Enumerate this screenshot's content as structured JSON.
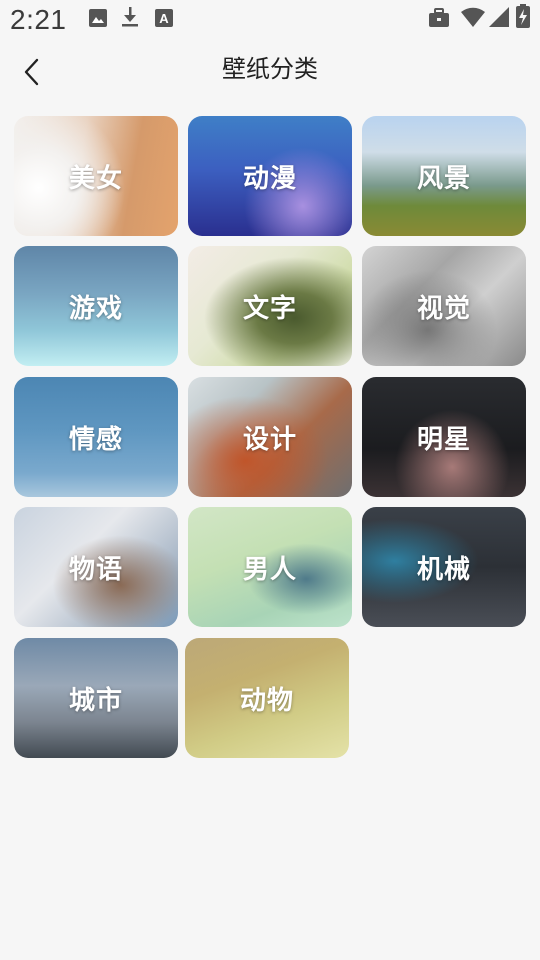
{
  "status_bar": {
    "time": "2:21",
    "left_icons": [
      "image-icon",
      "download-icon",
      "font-icon"
    ],
    "right_icons": [
      "briefcase-icon",
      "wifi-icon",
      "signal-icon",
      "battery-charging-icon"
    ]
  },
  "header": {
    "back_icon": "chevron-left-icon",
    "title": "壁纸分类"
  },
  "categories": [
    {
      "label": "美女"
    },
    {
      "label": "动漫"
    },
    {
      "label": "风景"
    },
    {
      "label": "游戏"
    },
    {
      "label": "文字"
    },
    {
      "label": "视觉"
    },
    {
      "label": "情感"
    },
    {
      "label": "设计"
    },
    {
      "label": "明星"
    },
    {
      "label": "物语"
    },
    {
      "label": "男人"
    },
    {
      "label": "机械"
    },
    {
      "label": "城市"
    },
    {
      "label": "动物"
    }
  ]
}
